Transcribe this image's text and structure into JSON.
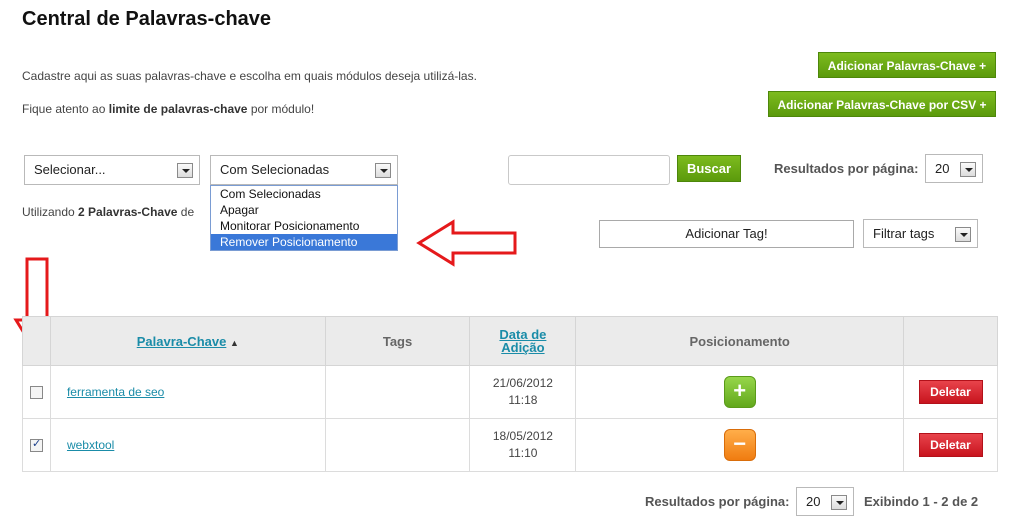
{
  "page": {
    "title": "Central de Palavras-chave",
    "intro_line1": "Cadastre aqui as suas palavras-chave e escolha em quais módulos deseja utilizá-las.",
    "intro_line2_pre": "Fique atento ao ",
    "intro_line2_bold": "limite de palavras-chave",
    "intro_line2_post": " por módulo!"
  },
  "actions": {
    "add_keywords": "Adicionar Palavras-Chave +",
    "add_keywords_csv": "Adicionar Palavras-Chave por CSV +"
  },
  "filters": {
    "select_value": "Selecionar...",
    "bulk_value": "Com Selecionadas",
    "bulk_options": [
      "Com Selecionadas",
      "Apagar",
      "Monitorar Posicionamento",
      "Remover Posicionamento"
    ],
    "bulk_selected_index": 3,
    "search_button": "Buscar",
    "results_per_page_label": "Resultados por página:",
    "results_per_page_value": "20",
    "usage_pre": "Utilizando ",
    "usage_bold": "2 Palavras-Chave",
    "usage_post": " de",
    "add_tag_button": "Adicionar Tag!",
    "filter_tags_value": "Filtrar tags"
  },
  "table": {
    "headers": {
      "keyword": "Palavra-Chave",
      "keyword_sort": "▲",
      "tags": "Tags",
      "date_line1": "Data de",
      "date_line2": "Adição",
      "position": "Posicionamento"
    },
    "rows": [
      {
        "checked": false,
        "keyword": "ferramenta de seo",
        "tags": "",
        "date": "21/06/2012",
        "time": "11:18",
        "position_icon": "plus-icon",
        "position_symbol": "+",
        "delete_label": "Deletar"
      },
      {
        "checked": true,
        "keyword": "webxtool",
        "tags": "",
        "date": "18/05/2012",
        "time": "11:10",
        "position_icon": "minus-icon",
        "position_symbol": "−",
        "delete_label": "Deletar"
      }
    ]
  },
  "footer": {
    "results_per_page_label": "Resultados por página:",
    "results_per_page_value": "20",
    "showing_pre": "Exibindo ",
    "showing_bold": "1 - 2 de 2"
  },
  "colors": {
    "accent_green": "#6aa814",
    "link_teal": "#1a8ca8",
    "delete_red": "#d42029",
    "annotation_red": "#e5191b"
  }
}
